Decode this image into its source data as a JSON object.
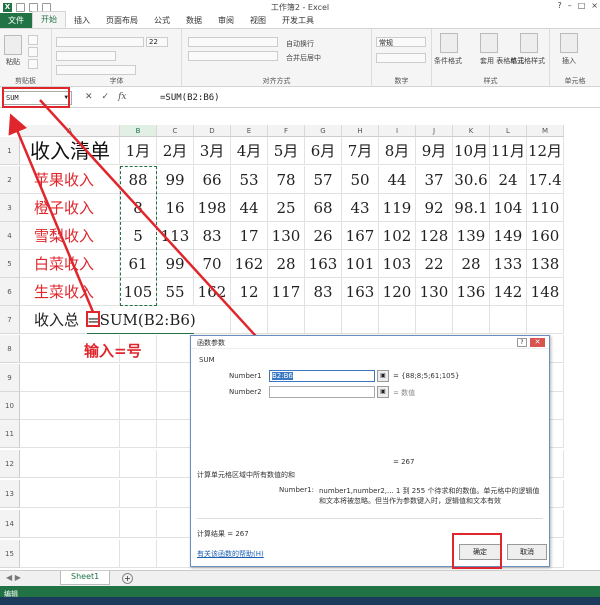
{
  "window": {
    "title": "工作簿2 - Excel"
  },
  "tabs": [
    {
      "label": "文件",
      "kind": "file"
    },
    {
      "label": "开始",
      "kind": "active"
    },
    {
      "label": "插入",
      "kind": ""
    },
    {
      "label": "页面布局",
      "kind": ""
    },
    {
      "label": "公式",
      "kind": ""
    },
    {
      "label": "数据",
      "kind": ""
    },
    {
      "label": "审阅",
      "kind": ""
    },
    {
      "label": "视图",
      "kind": ""
    },
    {
      "label": "开发工具",
      "kind": ""
    }
  ],
  "ribbon": {
    "paste": "粘贴",
    "clipboard": "剪贴板",
    "font_size": "22",
    "font": "字体",
    "wrap": "自动换行",
    "merge": "合并后居中",
    "align": "对齐方式",
    "number_format": "常规",
    "number": "数字",
    "cond_format": "条件格式",
    "table_format": "套用\n表格格式",
    "cell_style": "单元格样式",
    "styles": "样式",
    "insert": "插入",
    "cells": "单元格"
  },
  "formula_bar": {
    "name_box": "SUM",
    "formula": "=SUM(B2:B6)"
  },
  "columns": [
    "A",
    "B",
    "C",
    "D",
    "E",
    "F",
    "G",
    "H",
    "I",
    "J",
    "K",
    "L",
    "M"
  ],
  "rows": [
    "1",
    "2",
    "3",
    "4",
    "5",
    "6",
    "7",
    "8",
    "9",
    "10",
    "11",
    "12",
    "13",
    "14",
    "15"
  ],
  "sheet": {
    "title": "收入清单",
    "months": [
      "1月",
      "2月",
      "3月",
      "4月",
      "5月",
      "6月",
      "7月",
      "8月",
      "9月",
      "10月",
      "11月",
      "12月"
    ],
    "data": [
      {
        "label": "苹果收入",
        "values": [
          "88",
          "99",
          "66",
          "53",
          "78",
          "57",
          "50",
          "44",
          "37",
          "30.6",
          "24",
          "17.4"
        ]
      },
      {
        "label": "橙子收入",
        "values": [
          "8",
          "16",
          "198",
          "44",
          "25",
          "68",
          "43",
          "119",
          "92",
          "98.1",
          "104",
          "110"
        ]
      },
      {
        "label": "雪梨收入",
        "values": [
          "5",
          "113",
          "83",
          "17",
          "130",
          "26",
          "167",
          "102",
          "128",
          "139",
          "149",
          "160"
        ]
      },
      {
        "label": "白菜收入",
        "values": [
          "61",
          "99",
          "70",
          "162",
          "28",
          "163",
          "101",
          "103",
          "22",
          "28",
          "133",
          "138"
        ]
      },
      {
        "label": "生菜收入",
        "values": [
          "105",
          "55",
          "162",
          "12",
          "117",
          "83",
          "163",
          "120",
          "130",
          "136",
          "142",
          "148"
        ]
      }
    ],
    "sum_label": "收入总",
    "sum_formula": "=SUM(B2:B6)"
  },
  "annotation": {
    "text": "输入=号"
  },
  "dialog": {
    "title": "函数参数",
    "func": "SUM",
    "number1_label": "Number1",
    "number1_value": "B2:B6",
    "number1_result": "= {88;8;5;61;105}",
    "number2_label": "Number2",
    "number2_result": "= 数值",
    "total": "=  267",
    "description": "计算单元格区域中所有数值的和",
    "arg_name": "Number1:",
    "arg_desc_1": "number1,number2,... 1 到 255 个待求和的数值。单元格中的逻辑值",
    "arg_desc_2": "和文本将被忽略。但当作为参数键入时，逻辑值和文本有效",
    "calc_result": "计算结果 =  267",
    "help_link": "有关该函数的帮助(H)",
    "ok": "确定",
    "cancel": "取消"
  },
  "sheet_tab": "Sheet1",
  "status": "编辑",
  "colors": {
    "excel_green": "#217346",
    "annotation_red": "#e0262d"
  }
}
